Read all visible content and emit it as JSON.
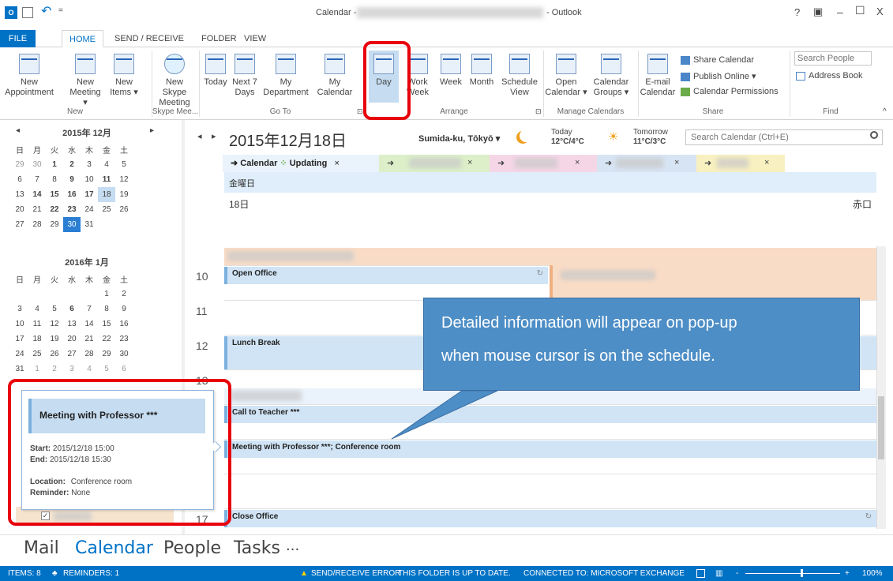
{
  "window": {
    "title_prefix": "Calendar -",
    "title_suffix": "- Outlook",
    "help": "?",
    "ribbon_opt": "▣",
    "minimize": "–",
    "maximize": "☐",
    "close": "X",
    "undo": "↶",
    "dropdown": "="
  },
  "tabs": [
    "FILE",
    "HOME",
    "SEND / RECEIVE",
    "FOLDER",
    "VIEW"
  ],
  "ribbon": {
    "new_appointment": [
      "New",
      "Appointment"
    ],
    "new_meeting": [
      "New",
      "Meeting ▾"
    ],
    "new_items": [
      "New",
      "Items ▾"
    ],
    "new_skype": [
      "New Skype",
      "Meeting"
    ],
    "today": "Today",
    "next7": [
      "Next 7",
      "Days"
    ],
    "my_dept": [
      "My",
      "Department"
    ],
    "my_cal": [
      "My",
      "Calendar"
    ],
    "day": "Day",
    "work_week": [
      "Work",
      "Week"
    ],
    "week": "Week",
    "month": "Month",
    "schedule": [
      "Schedule",
      "View"
    ],
    "open_cal": [
      "Open",
      "Calendar ▾"
    ],
    "cal_groups": [
      "Calendar",
      "Groups ▾"
    ],
    "email_cal": [
      "E-mail",
      "Calendar"
    ],
    "share_cal": "Share Calendar",
    "publish": "Publish Online ▾",
    "permissions": "Calendar Permissions",
    "search_people": "Search People",
    "address_book": "Address Book",
    "groups": {
      "new": "New",
      "skype": "Skype Mee...",
      "goto": "Go To",
      "arrange": "Arrange",
      "manage": "Manage Calendars",
      "share": "Share",
      "find": "Find"
    },
    "launcher": "⊡",
    "collapse": "^"
  },
  "mini1": {
    "title": "2015年 12月",
    "prev": "◂",
    "next": "▸",
    "dow": [
      "日",
      "月",
      "火",
      "水",
      "木",
      "金",
      "土"
    ],
    "weeks": [
      [
        "29",
        "30",
        "1",
        "2",
        "3",
        "4",
        "5"
      ],
      [
        "6",
        "7",
        "8",
        "9",
        "10",
        "11",
        "12"
      ],
      [
        "13",
        "14",
        "15",
        "16",
        "17",
        "18",
        "19"
      ],
      [
        "20",
        "21",
        "22",
        "23",
        "24",
        "25",
        "26"
      ],
      [
        "27",
        "28",
        "29",
        "30",
        "31",
        "",
        ""
      ]
    ]
  },
  "mini2": {
    "title": "2016年 1月",
    "dow": [
      "日",
      "月",
      "火",
      "水",
      "木",
      "金",
      "土"
    ],
    "weeks": [
      [
        "",
        "",
        "",
        "",
        "",
        "1",
        "2"
      ],
      [
        "3",
        "4",
        "5",
        "6",
        "7",
        "8",
        "9"
      ],
      [
        "10",
        "11",
        "12",
        "13",
        "14",
        "15",
        "16"
      ],
      [
        "17",
        "18",
        "19",
        "20",
        "21",
        "22",
        "23"
      ],
      [
        "24",
        "25",
        "26",
        "27",
        "28",
        "29",
        "30"
      ],
      [
        "31",
        "1",
        "2",
        "3",
        "4",
        "5",
        "6"
      ]
    ]
  },
  "calendar": {
    "date": "2015年12月18日",
    "location": "Sumida-ku, Tōkyō ▾",
    "today_label": "Today",
    "today_temp": "12°C/4°C",
    "tomorrow_label": "Tomorrow",
    "tomorrow_temp": "11°C/3°C",
    "search_placeholder": "Search Calendar (Ctrl+E)",
    "tab1": "Calendar",
    "tab1_status": "Updating",
    "tab_close": "×",
    "weekday": "金曜日",
    "day_num": "18日",
    "rokuyo": "赤口",
    "hours": [
      "10",
      "11",
      "12",
      "13",
      "17"
    ],
    "appt_open": "Open Office",
    "appt_lunch": "Lunch Break",
    "appt_call": "Call to Teacher ***",
    "appt_meeting": "Meeting with Professor ***; Conference room",
    "appt_close": "Close Office"
  },
  "callout": {
    "line1": "Detailed information will appear on pop-up",
    "line2": "when mouse cursor is on the schedule."
  },
  "popup": {
    "title": "Meeting with Professor ***",
    "start_label": "Start:",
    "start": "2015/12/18   15:00",
    "end_label": "End:",
    "end": "2015/12/18   15:30",
    "location_label": "Location:",
    "location": "Conference room",
    "reminder_label": "Reminder:",
    "reminder": "None"
  },
  "navbar": {
    "mail": "Mail",
    "calendar": "Calendar",
    "people": "People",
    "tasks": "Tasks",
    "more": "···"
  },
  "status": {
    "items": "ITEMS: 8",
    "reminders": "REMINDERS: 1",
    "error": "SEND/RECEIVE ERROR",
    "uptodate": "THIS FOLDER IS UP TO DATE.",
    "connected": "CONNECTED TO: MICROSOFT EXCHANGE",
    "zoom": "100%",
    "minus": "-",
    "plus": "+"
  },
  "colors": {
    "accent": "#0072c6",
    "highlight": "#e8000b",
    "callout": "#4e8ec6",
    "appt": "#d0e4f5",
    "peach": "#f9dcc6"
  }
}
